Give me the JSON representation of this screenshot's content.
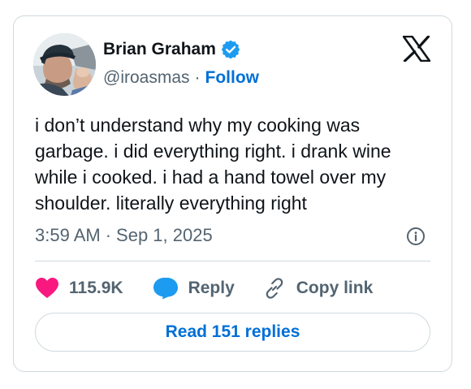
{
  "author": {
    "name": "Brian Graham",
    "handle": "@iroasmas",
    "separator": "·",
    "follow_label": "Follow",
    "verified_color": "#1d9bf0"
  },
  "tweet": {
    "text": "i don’t understand why my cooking was\ngarbage. i did everything right. i drank wine\nwhile i cooked. i had a hand towel over my\nshoulder. literally everything right",
    "time": "3:59 AM",
    "separator": "·",
    "date": "Sep 1, 2025"
  },
  "actions": {
    "like_count": "115.9K",
    "like_color": "#f91880",
    "reply_label": "Reply",
    "reply_color": "#1d9bf0",
    "copy_label": "Copy link"
  },
  "footer": {
    "read_replies_label": "Read 151 replies"
  },
  "icons": {
    "brand": "x-logo-icon",
    "info": "info-icon",
    "like": "heart-icon",
    "reply": "speech-bubble-icon",
    "copy": "link-icon",
    "verified": "verified-badge-icon"
  }
}
